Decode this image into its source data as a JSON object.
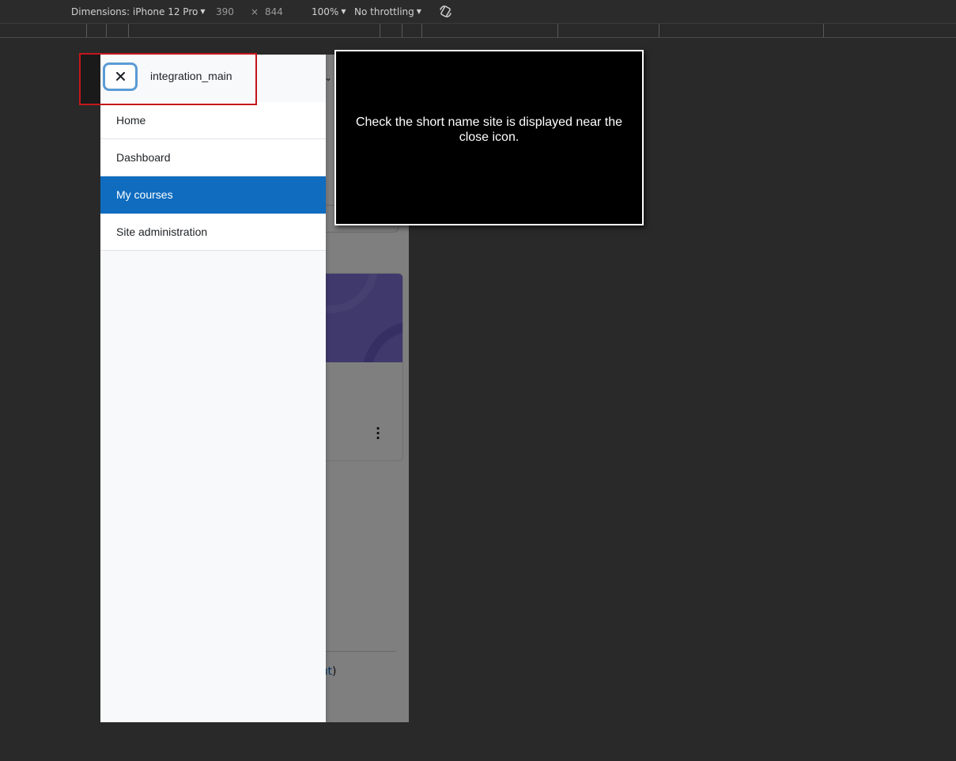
{
  "devtools": {
    "dimensions_label": "Dimensions: iPhone 12 Pro",
    "width": "390",
    "times": "×",
    "height": "844",
    "zoom": "100%",
    "throttling": "No throttling"
  },
  "page": {
    "logout_text": "out",
    "logout_paren": ")"
  },
  "drawer": {
    "site_short_name": "integration_main",
    "close_icon": "close-icon",
    "nav_items": [
      {
        "label": "Home",
        "active": false
      },
      {
        "label": "Dashboard",
        "active": false
      },
      {
        "label": "My courses",
        "active": true
      },
      {
        "label": "Site administration",
        "active": false
      }
    ]
  },
  "tooltip": {
    "text": "Check the short name site is displayed near the close icon."
  },
  "colors": {
    "accent": "#0f6cbf",
    "highlight": "#c4161c",
    "focus_ring": "#5b9bd5"
  }
}
